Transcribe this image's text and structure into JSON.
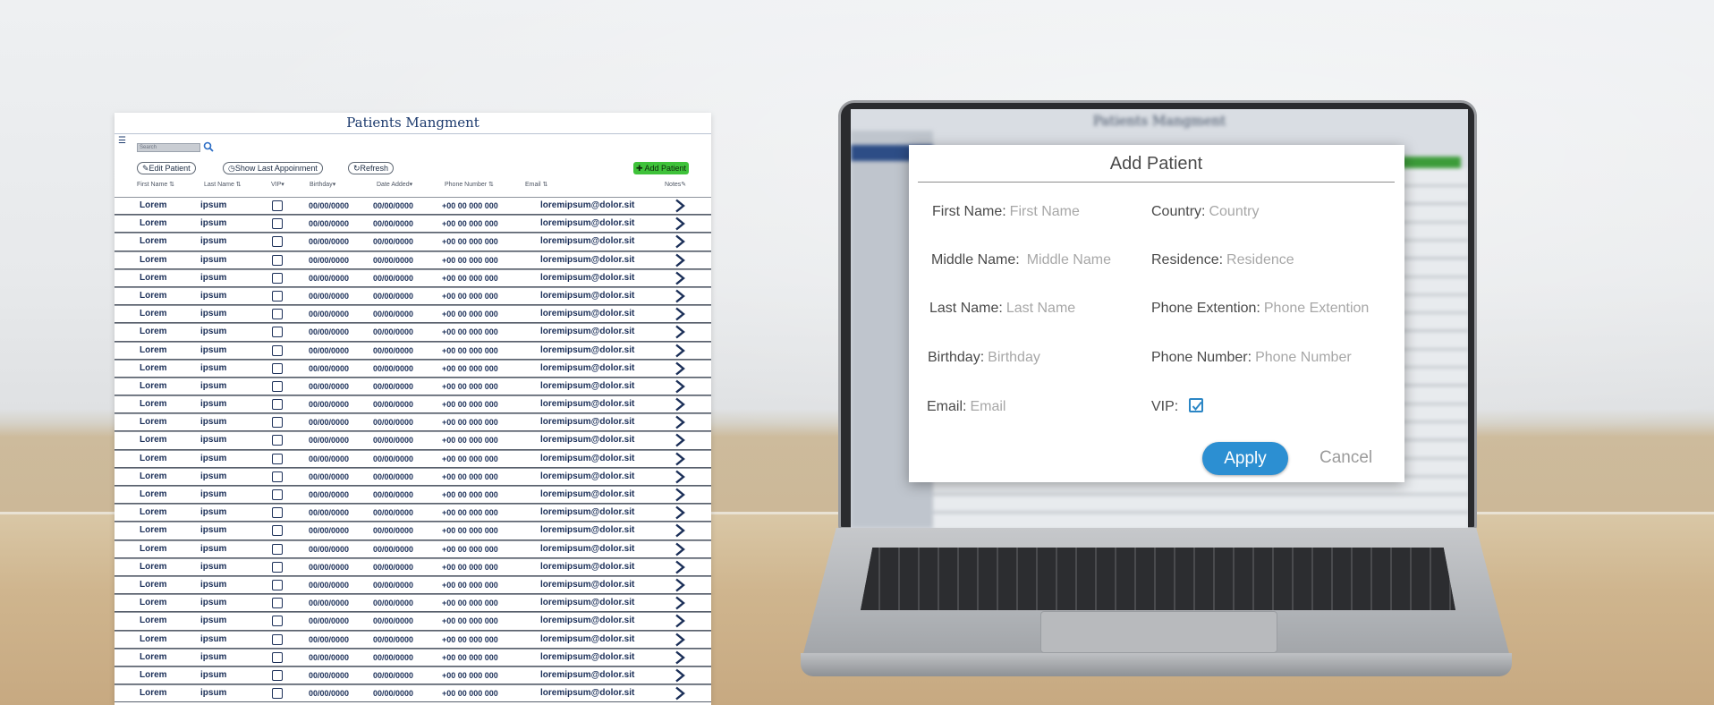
{
  "panel": {
    "title": "Patients Mangment",
    "search_placeholder": "Search",
    "toolbar": {
      "edit_label": "Edit Patient",
      "show_last_label": "Show Last Appoinment",
      "refresh_label": "Refresh",
      "add_label": "Add Patient"
    },
    "columns": [
      "First Name",
      "Last Name",
      "VIP",
      "Birthday",
      "Date Added",
      "Phone Number",
      "Email",
      "Notes"
    ],
    "row_template": {
      "first_name": "Lorem",
      "last_name": "ipsum",
      "birthday": "00/00/0000",
      "date_added": "00/00/0000",
      "phone": "+00 00 000 000",
      "email": "loremipsum@dolor.sit"
    },
    "row_count": 28
  },
  "modal": {
    "title": "Add Patient",
    "fields": {
      "first_name": {
        "label": "First Name:",
        "placeholder": "First Name"
      },
      "middle_name": {
        "label": "Middle Name:",
        "placeholder": "Middle Name"
      },
      "last_name": {
        "label": "Last Name:",
        "placeholder": "Last Name"
      },
      "birthday": {
        "label": "Birthday:",
        "placeholder": "Birthday"
      },
      "email": {
        "label": "Email:",
        "placeholder": "Email"
      },
      "country": {
        "label": "Country:",
        "placeholder": "Country"
      },
      "residence": {
        "label": "Residence:",
        "placeholder": "Residence"
      },
      "phone_ext": {
        "label": "Phone Extention:",
        "placeholder": "Phone Extention"
      },
      "phone_number": {
        "label": "Phone Number:",
        "placeholder": "Phone Number"
      },
      "vip": {
        "label": "VIP:",
        "checked": true
      }
    },
    "apply_label": "Apply",
    "cancel_label": "Cancel"
  },
  "colors": {
    "accent": "#2c8fd2",
    "add_button": "#3fc23a",
    "navy_text": "#1b2f58"
  },
  "icons": {
    "menu": "menu-icon",
    "search": "search-icon",
    "edit": "pencil-icon",
    "history": "clock-icon",
    "refresh": "refresh-icon",
    "add": "plus-icon",
    "row_action": "chevron-right-icon",
    "vip_checkbox": "checkbox-icon"
  }
}
